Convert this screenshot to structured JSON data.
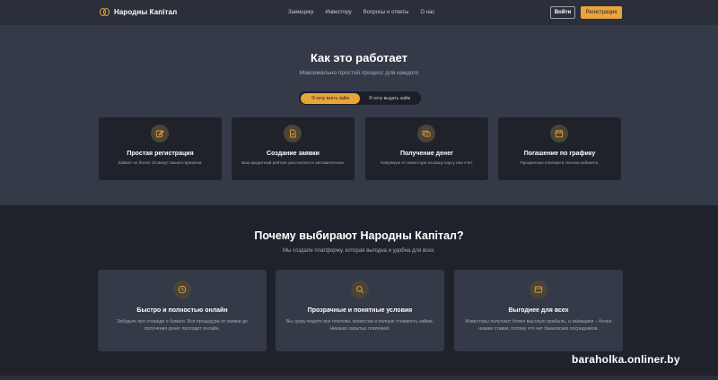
{
  "header": {
    "brand": "Народны Капітал",
    "menu": [
      "Заемщику",
      "Инвестору",
      "Вопросы и ответы",
      "О нас"
    ],
    "login_label": "Войти",
    "register_label": "Регистрация"
  },
  "how": {
    "title": "Как это работает",
    "subtitle": "Максимально простой процесс для каждого",
    "toggle": {
      "active": "Я хочу взять займ",
      "inactive": "Я хочу выдать займ"
    },
    "steps": [
      {
        "icon": "pencil-square-icon",
        "title": "Простая регистрация",
        "desc": "Займет не более 10 минут вашего времени."
      },
      {
        "icon": "document-icon",
        "title": "Создание заявки",
        "desc": "Ваш кредитный рейтинг рассчитается автоматически."
      },
      {
        "icon": "money-icon",
        "title": "Получение денег",
        "desc": "Напрямую от инвестора на вашу карту или счет."
      },
      {
        "icon": "calendar-icon",
        "title": "Погашение по графику",
        "desc": "Прозрачные платежи в личном кабинете."
      }
    ]
  },
  "why": {
    "title": "Почему выбирают Народны Капітал?",
    "subtitle": "Мы создали платформу, которая выгодна и удобна для всех.",
    "features": [
      {
        "icon": "clock-icon",
        "title": "Быстро и полностью онлайн",
        "desc": "Забудьте про очереди и бумаги. Вся процедура от заявки до получения денег проходит онлайн."
      },
      {
        "icon": "magnifier-icon",
        "title": "Прозрачные и понятные условия",
        "desc": "Вы сразу видите все платежи, комиссии и полную стоимость займа. Никаких скрытых платежей."
      },
      {
        "icon": "wallet-icon",
        "title": "Выгоднее для всех",
        "desc": "Инвесторы получают более высокую прибыль, а заёмщики – более низкие ставки, потому что нет банковских посредников."
      }
    ]
  },
  "watermark": "baraholka.onliner.by",
  "colors": {
    "accent": "#e9a43a",
    "header_bg": "#2b2f3a",
    "section_light": "#353a48",
    "section_dark": "#1f222b"
  }
}
